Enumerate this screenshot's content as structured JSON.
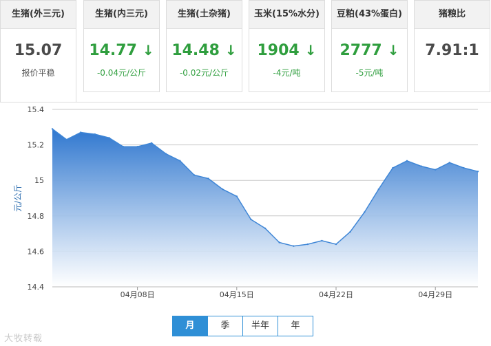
{
  "cards": [
    {
      "title": "生猪(外三元)",
      "value": "15.07",
      "change": "报价平稳",
      "trend": "flat"
    },
    {
      "title": "生猪(内三元)",
      "value": "14.77",
      "change": "-0.04元/公斤",
      "trend": "down"
    },
    {
      "title": "生猪(土杂猪)",
      "value": "14.48",
      "change": "-0.02元/公斤",
      "trend": "down"
    },
    {
      "title": "玉米(15%水分)",
      "value": "1904",
      "change": "-4元/吨",
      "trend": "down"
    },
    {
      "title": "豆粕(43%蛋白)",
      "value": "2777",
      "change": "-5元/吨",
      "trend": "down"
    },
    {
      "title": "猪粮比",
      "value": "7.91:1",
      "change": "",
      "trend": "flat"
    }
  ],
  "down_arrow": "↓",
  "range_buttons": [
    "月",
    "季",
    "半年",
    "年"
  ],
  "range_selected": "月",
  "watermark": "大牧转载",
  "colors": {
    "line": "#3f86d6",
    "fill_top": "#2f77cf",
    "fill_bottom": "#ffffff",
    "down": "#2f9e3e",
    "button": "#2f8fd6"
  },
  "chart_data": {
    "type": "area",
    "title": "",
    "xlabel": "",
    "ylabel": "元/公斤",
    "ylim": [
      14.4,
      15.4
    ],
    "yticks": [
      14.4,
      14.6,
      14.8,
      15,
      15.2,
      15.4
    ],
    "ytick_labels": [
      "14.4",
      "14.6",
      "14.8",
      "15",
      "15.2",
      "15.4"
    ],
    "xticks": [
      "04月08日",
      "04月15日",
      "04月22日",
      "04月29日"
    ],
    "xtick_index": [
      6,
      13,
      20,
      27
    ],
    "grid": true,
    "legend": "none",
    "series": [
      {
        "x": [
          "04月02日",
          "04月03日",
          "04月04日",
          "04月05日",
          "04月06日",
          "04月07日",
          "04月08日",
          "04月09日",
          "04月10日",
          "04月11日",
          "04月12日",
          "04月13日",
          "04月14日",
          "04月15日",
          "04月16日",
          "04月17日",
          "04月18日",
          "04月19日",
          "04月20日",
          "04月21日",
          "04月22日",
          "04月23日",
          "04月24日",
          "04月25日",
          "04月26日",
          "04月27日",
          "04月28日",
          "04月29日",
          "04月30日",
          "05月01日",
          "05月02日"
        ],
        "values": [
          15.29,
          15.23,
          15.27,
          15.26,
          15.24,
          15.19,
          15.19,
          15.21,
          15.15,
          15.11,
          15.03,
          15.01,
          14.95,
          14.91,
          14.78,
          14.73,
          14.65,
          14.63,
          14.64,
          14.66,
          14.64,
          14.71,
          14.82,
          14.95,
          15.07,
          15.11,
          15.08,
          15.06,
          15.1,
          15.07,
          15.05
        ]
      }
    ]
  }
}
